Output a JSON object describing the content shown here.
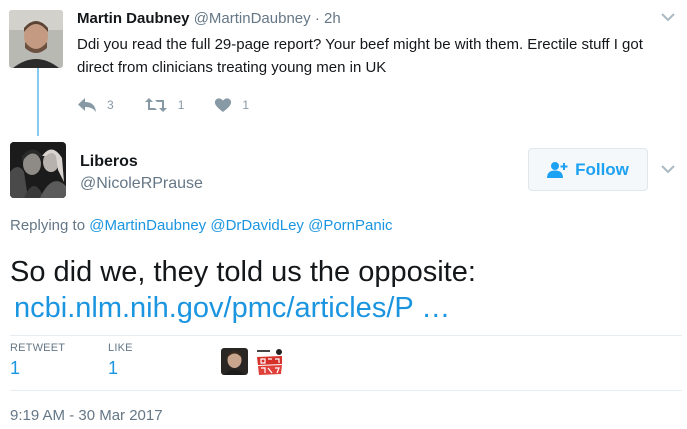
{
  "parent_tweet": {
    "author_name": "Martin Daubney",
    "author_handle": "@MartinDaubney",
    "separator": "·",
    "time": "2h",
    "text": "Ddi you read the full 29-page report? Your beef might be with them. Erectile stuff I got direct from clinicians treating young men in UK",
    "reply_count": "3",
    "retweet_count": "1",
    "like_count": "1"
  },
  "main_tweet": {
    "author_name": "Liberos",
    "author_handle": "@NicoleRPrause",
    "follow_label": "Follow",
    "replying_prefix": "Replying to",
    "replying_to": [
      "@MartinDaubney",
      "@DrDavidLey",
      "@PornPanic"
    ],
    "text": "So did we, they told us the opposite:",
    "link_text": "ncbi.nlm.nih.gov/pmc/articles/P …",
    "retweets_label": "RETWEET",
    "retweets_value": "1",
    "likes_label": "LIKE",
    "likes_value": "1",
    "liker_logo_text": "PORN\nPANIC!",
    "timestamp": "9:19 AM - 30 Mar 2017"
  },
  "colors": {
    "link": "#1b95e0",
    "muted": "#657786",
    "icon": "#8899a6",
    "thread_line": "#88c9f0"
  },
  "icons": [
    "reply-icon",
    "retweet-icon",
    "heart-icon",
    "chevron-down-icon",
    "follow-person-icon"
  ]
}
